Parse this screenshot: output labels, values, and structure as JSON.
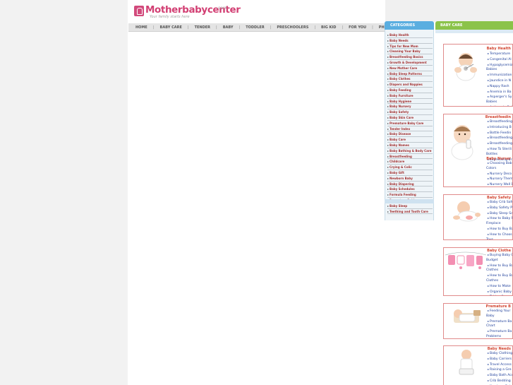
{
  "site": {
    "logo_name": "Motherbabycenter",
    "logo_tld": ".com",
    "tagline": "Your family starts here"
  },
  "nav": [
    "HOME",
    "BABY CARE",
    "TENDER",
    "BABY",
    "TODDLER",
    "PRESCHOOLERS",
    "BIG KID",
    "FOR YOU",
    "PHOTOS"
  ],
  "categories": {
    "header": "CATEGORIES",
    "items": [
      "Baby Health",
      "Baby Needs",
      "Tips for New Mom",
      "Cleaning Your Baby",
      "Breastfeeding Basics",
      "Growth & Development",
      "New Mother Care",
      "Baby Sleep Patterns",
      "Baby Clothes",
      "Diapers and Nappies",
      "Baby Feeding",
      "Baby Furniture",
      "Baby Hygiene",
      "Baby Nursery",
      "Baby Safety",
      "Baby Skin Care",
      "Premature Baby Care",
      "Tender Index",
      "Baby Disease",
      "Baby Care",
      "Baby Names",
      "Baby Bathing & Body Care",
      "Breastfeeding",
      "Childcare",
      "Crying & Colic",
      "Baby Gift",
      "Newborn Baby",
      "Baby Diapering",
      "Baby Schedules",
      "Formula Feeding",
      "Premature Babies",
      "Baby Sleep",
      "Teething and Tooth Care"
    ]
  },
  "baby_care": {
    "header": "BABY CARE",
    "blocks": [
      {
        "title": "Baby Health",
        "subtitle": "",
        "links": [
          "Temperature",
          "Congenital Al",
          "Hypoglycemia",
          "Babies",
          "Immunization",
          "Jaundice in N",
          "Nappy Rash",
          "Anemia in Ba",
          "Asperger's Sy",
          "Babies",
          "Asthma in Bab",
          "Autism in Bab"
        ]
      },
      {
        "title": "Breastfeedin",
        "subtitle": "Baby Nurser",
        "links": [
          "Breastfeeding",
          "Introducing B",
          "Bottle Feedin",
          "Breastfeeding",
          "Breastfeeding",
          "How To Sterili",
          "Bottles",
          "Expressing Br"
        ],
        "links2": [
          "Choosing Bab",
          "Colors",
          "Nursery Deco",
          "Nursery Them",
          "Nursery Wall D"
        ]
      },
      {
        "title": "Baby Safety",
        "subtitle": "",
        "links": [
          "Baby Crib Safe",
          "Baby Safety P",
          "Baby Sleep Sa",
          "How to Baby P",
          "Fireplace",
          "How to Buy Ba",
          "How to Choos",
          "Toys",
          "How to Install"
        ]
      },
      {
        "title": "Baby Clothe",
        "subtitle": "",
        "links": [
          "Buying Baby C",
          "Budget",
          "How to Buy Ba",
          "Clothes",
          "How to Buy Ba",
          "Clothes",
          "How to Make",
          "Organic Baby",
          "Taking Care o",
          "Clothes"
        ]
      },
      {
        "title": "Premature B",
        "subtitle": "",
        "links": [
          "Feeding Your",
          "Baby",
          "Premature Ba",
          "Chart",
          "Premature Ba",
          "Problems",
          "Premature Ba"
        ]
      },
      {
        "title": "Baby Needs",
        "subtitle": "",
        "links": [
          "Baby Clothing",
          "Baby Carriers",
          "Travel Access",
          "Raising a Gre",
          "Baby Bath Acc",
          "Crib Bedding",
          "Newborn Baby"
        ]
      }
    ]
  }
}
